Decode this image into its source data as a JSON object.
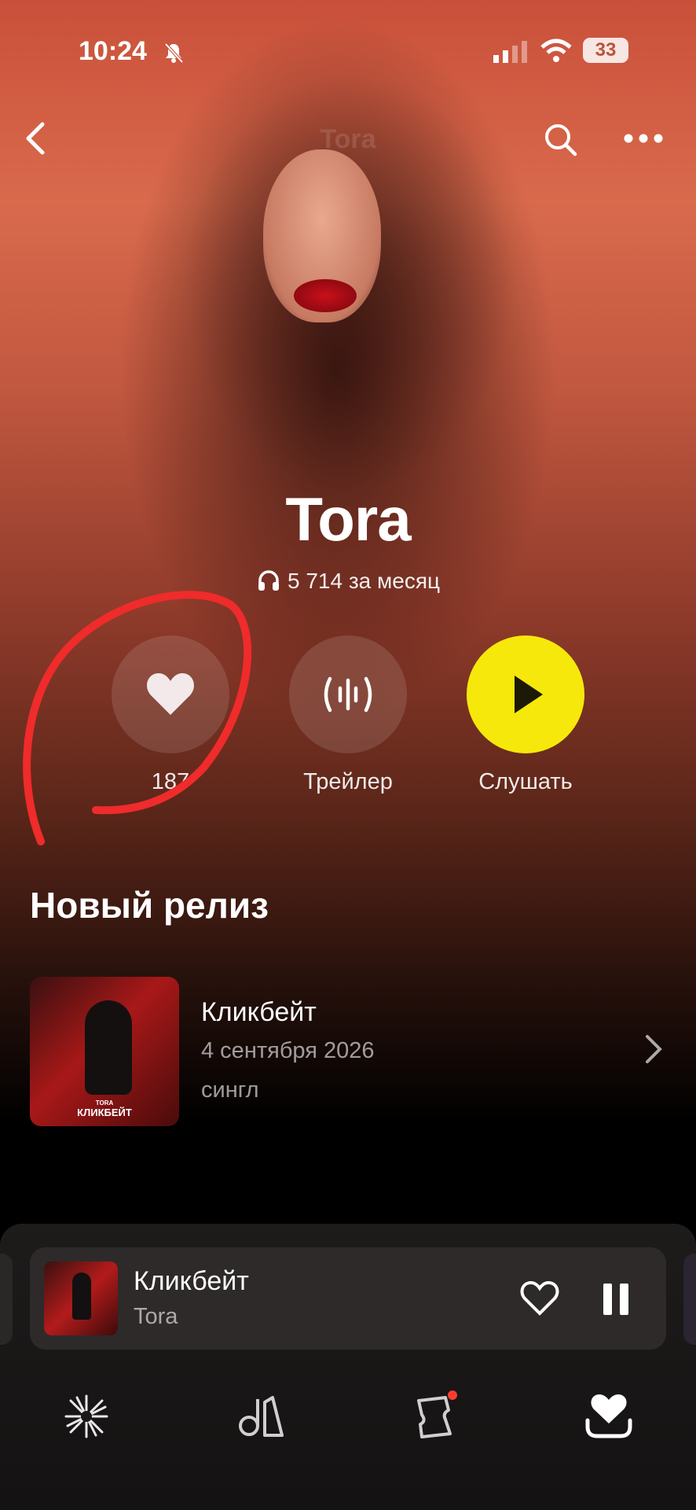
{
  "status_bar": {
    "time": "10:24",
    "battery": "33"
  },
  "header": {
    "title": "Tora"
  },
  "artist": {
    "name": "Tora",
    "monthly_listeners": "5 714 за месяц"
  },
  "actions": {
    "like_count": "187",
    "trailer_label": "Трейлер",
    "listen_label": "Слушать",
    "accent_color": "#f6e80a"
  },
  "new_release": {
    "section_title": "Новый релиз",
    "title": "Кликбейт",
    "date": "4 сентября 2026",
    "type": "сингл",
    "cover_artist": "TORA",
    "cover_title": "КЛИКБЕЙТ"
  },
  "now_playing": {
    "title": "Кликбейт",
    "artist": "Tora"
  },
  "bottom_nav": {
    "items": [
      "wave-icon",
      "collection-icon",
      "tickets-icon",
      "favorites-icon"
    ]
  }
}
